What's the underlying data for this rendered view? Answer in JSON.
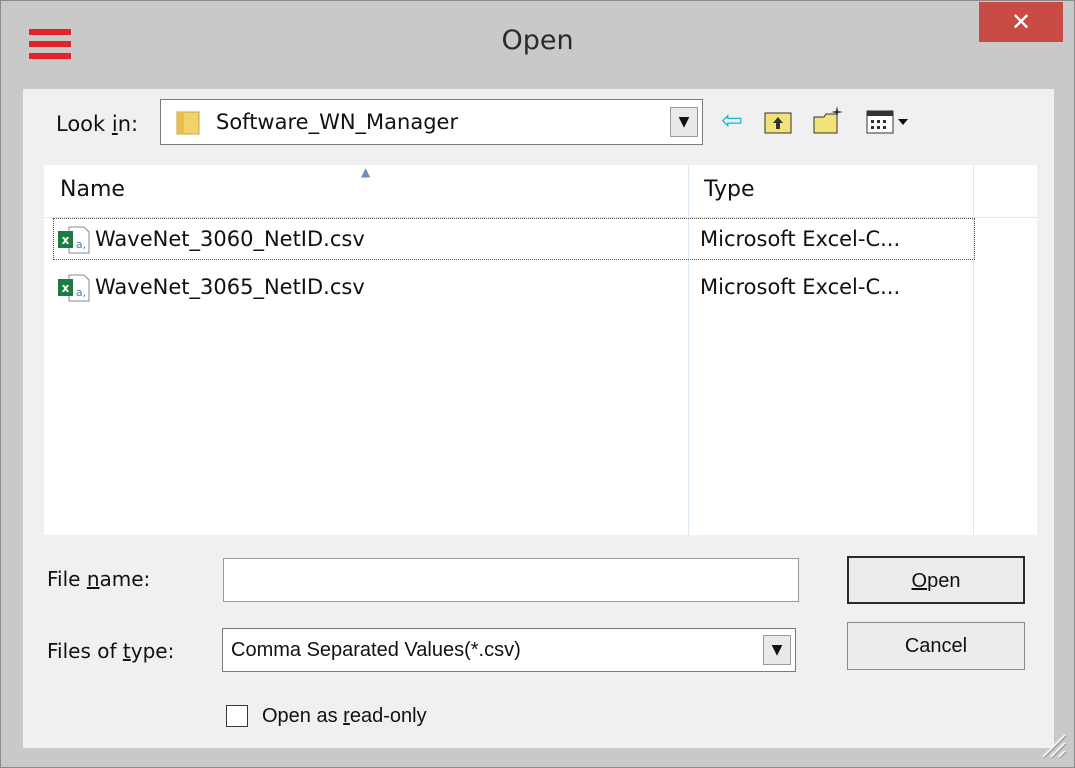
{
  "window": {
    "title": "Open",
    "close_glyph": "✕"
  },
  "lookin": {
    "label_pre": "Look ",
    "label_u": "i",
    "label_post": "n:",
    "value": "Software_WN_Manager",
    "folder_icon": "folder-icon"
  },
  "toolbar": {
    "back_icon": "back-arrow-icon",
    "up_icon": "up-folder-icon",
    "new_folder_icon": "new-folder-icon",
    "view_icon": "view-menu-icon"
  },
  "list": {
    "columns": [
      "Name",
      "Type"
    ],
    "files": [
      {
        "name": "WaveNet_3060_NetID.csv",
        "type": "Microsoft Excel-C..."
      },
      {
        "name": "WaveNet_3065_NetID.csv",
        "type": "Microsoft Excel-C..."
      }
    ],
    "file_icon": "excel-csv-icon"
  },
  "filename": {
    "label_pre": "File ",
    "label_u": "n",
    "label_post": "ame:",
    "value": ""
  },
  "filetype": {
    "label_pre": "Files of ",
    "label_u": "t",
    "label_post": "ype:",
    "value": "Comma Separated Values(*.csv)"
  },
  "buttons": {
    "open_u": "O",
    "open_rest": "pen",
    "cancel": "Cancel"
  },
  "readonly": {
    "pre": "Open as ",
    "u": "r",
    "post": "ead-only",
    "checked": false
  },
  "colors": {
    "accent_red": "#e3232b",
    "close_bg": "#c94b45",
    "excel_green": "#1e7a43",
    "folder_yellow": "#f2d36b"
  }
}
